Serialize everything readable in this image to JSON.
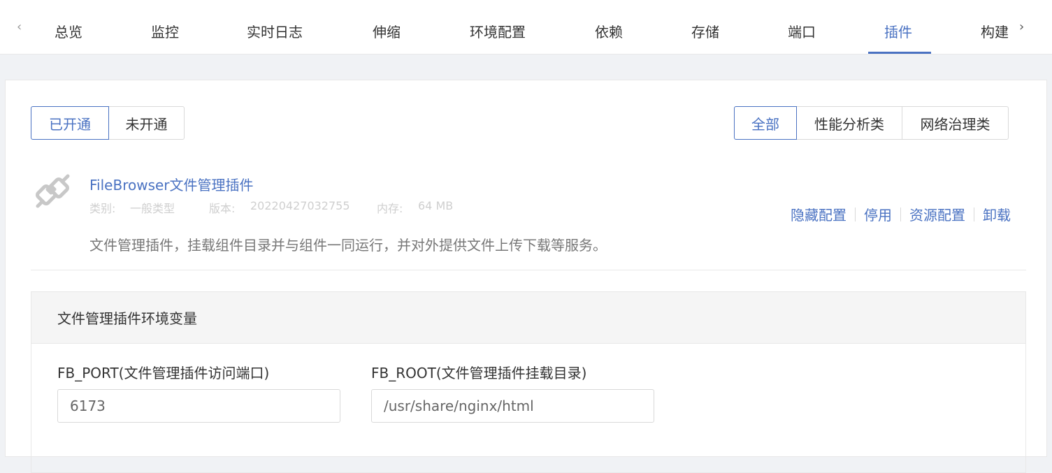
{
  "tabs": {
    "items": [
      "总览",
      "监控",
      "实时日志",
      "伸缩",
      "环境配置",
      "依赖",
      "存储",
      "端口",
      "插件",
      "构建"
    ],
    "active_index": 8,
    "prev_arrow": "‹",
    "next_arrow": "›"
  },
  "status_filter": {
    "options": [
      "已开通",
      "未开通"
    ],
    "active_index": 0
  },
  "category_filter": {
    "options": [
      "全部",
      "性能分析类",
      "网络治理类"
    ],
    "active_index": 0
  },
  "plugin": {
    "icon": "plug-icon",
    "title": "FileBrowser文件管理插件",
    "category_label": "类别:",
    "category_value": "一般类型",
    "version_label": "版本:",
    "version_value": "20220427032755",
    "memory_label": "内存:",
    "memory_value": "64 MB",
    "description": "文件管理插件，挂载组件目录并与组件一同运行，并对外提供文件上传下载等服务。",
    "actions": [
      "隐藏配置",
      "停用",
      "资源配置",
      "卸载"
    ]
  },
  "env": {
    "title": "文件管理插件环境变量",
    "fields": [
      {
        "label": "FB_PORT(文件管理插件访问端口)",
        "value": "6173"
      },
      {
        "label": "FB_ROOT(文件管理插件挂载目录)",
        "value": "/usr/share/nginx/html"
      }
    ]
  },
  "colors": {
    "accent": "#4a72c2",
    "page_bg": "#f0f2f5",
    "border": "#d9d9d9"
  }
}
